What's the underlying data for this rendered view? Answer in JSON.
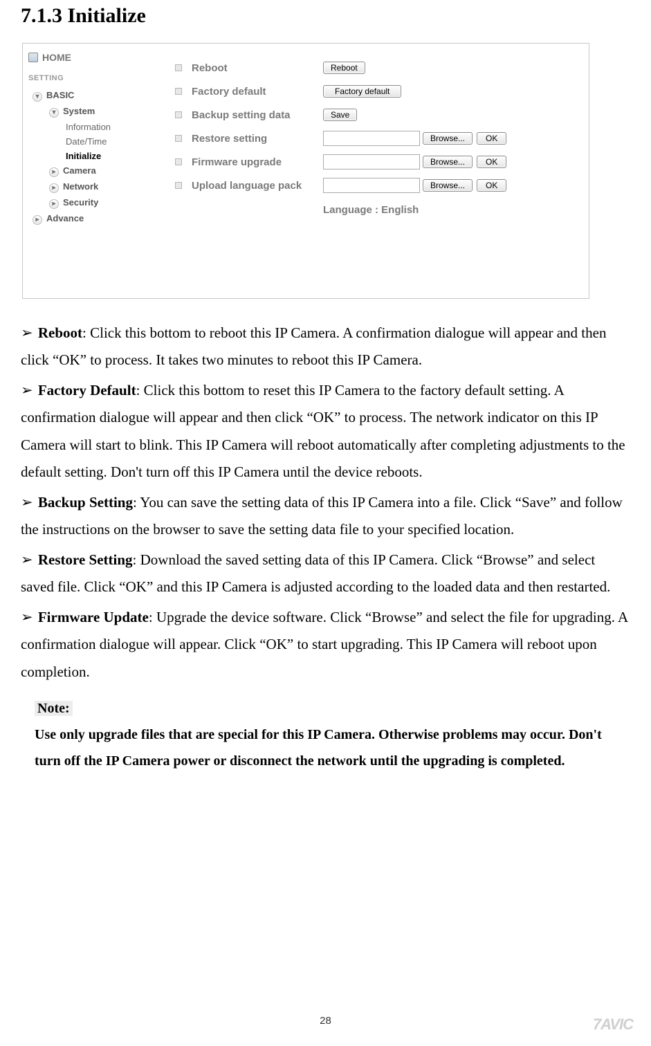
{
  "heading": "7.1.3 Initialize",
  "sidebar": {
    "home": "HOME",
    "setting": "SETTING",
    "basic": "BASIC",
    "system": "System",
    "information": "Information",
    "datetime": "Date/Time",
    "initialize": "Initialize",
    "camera": "Camera",
    "network": "Network",
    "security": "Security",
    "advance": "Advance"
  },
  "form": {
    "reboot_label": "Reboot",
    "reboot_btn": "Reboot",
    "factory_label": "Factory default",
    "factory_btn": "Factory default",
    "backup_label": "Backup setting data",
    "save_btn": "Save",
    "restore_label": "Restore setting",
    "firmware_label": "Firmware upgrade",
    "upload_label": "Upload language pack",
    "browse_btn": "Browse...",
    "ok_btn": "OK",
    "language_line": "Language : English"
  },
  "paras": {
    "p1a": "Reboot",
    "p1b": ": Click this bottom to reboot this IP Camera. A confirmation dialogue will appear and then click “OK” to process. It takes two minutes to reboot this IP Camera.",
    "p2a": "Factory Default",
    "p2b": ": Click this bottom to reset this IP Camera to the factory default setting. A confirmation dialogue will appear and then click “OK” to process. The network indicator on this IP Camera will start to blink. This IP Camera will reboot automatically after completing adjustments to the default setting. Don't turn off this IP Camera until the device reboots.",
    "p3a": "Backup Setting",
    "p3b": ": You can save the setting data of this IP Camera into a file. Click “Save” and follow the instructions on the browser to save the setting data file to your specified location.",
    "p4a": "Restore Setting",
    "p4b": ": Download the saved setting data of this IP Camera. Click “Browse” and select saved file. Click “OK” and this IP Camera is adjusted according to the loaded data and then restarted.",
    "p5a": "Firmware Update",
    "p5b": ": Upgrade the device software. Click “Browse” and select the file for upgrading. A confirmation dialogue will appear. Click “OK” to start upgrading. This IP Camera will reboot upon completion."
  },
  "note": {
    "label": "Note:",
    "text": "Use only upgrade files that are special for this IP Camera. Otherwise problems may occur. Don't turn off the IP Camera power or disconnect the network until the upgrading is completed."
  },
  "page_number": "28",
  "brand": "7AVIC"
}
